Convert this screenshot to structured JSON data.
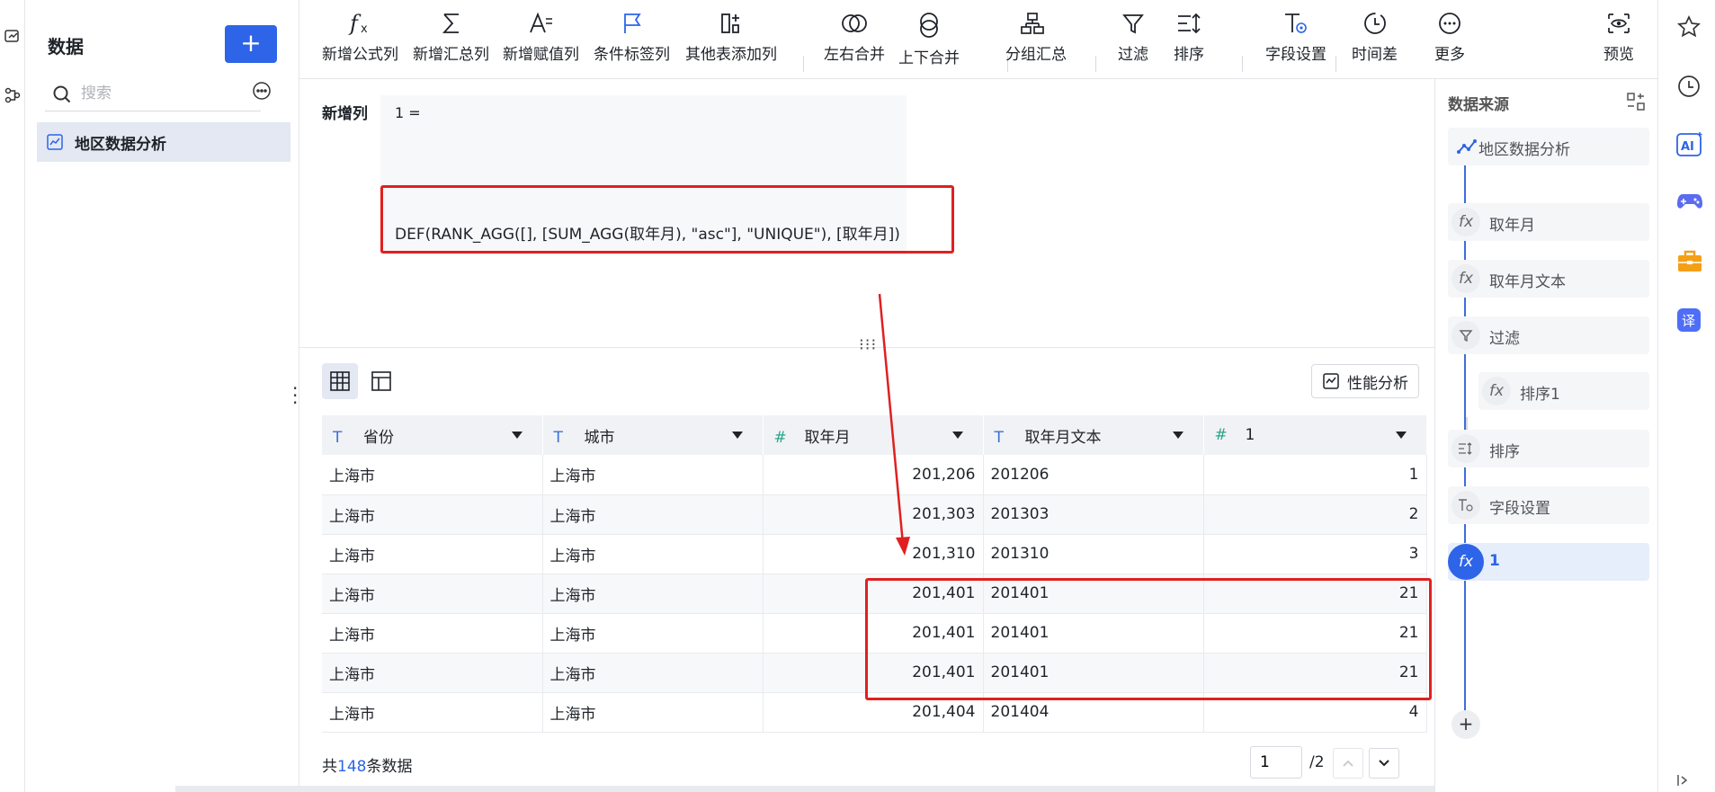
{
  "left_panel": {
    "title": "数据",
    "add_label": "+",
    "search_placeholder": "搜索",
    "dataset_name": "地区数据分析"
  },
  "toolbar": {
    "items": [
      {
        "label": "新增公式列",
        "icon": "formula-icon"
      },
      {
        "label": "新增汇总列",
        "icon": "sigma-icon"
      },
      {
        "label": "新增赋值列",
        "icon": "assign-icon"
      },
      {
        "label": "条件标签列",
        "icon": "flag-icon"
      },
      {
        "label": "其他表添加列",
        "icon": "add-column-icon"
      },
      {
        "label": "左右合并",
        "icon": "merge-horizontal-icon"
      },
      {
        "label": "上下合并",
        "icon": "merge-vertical-icon"
      },
      {
        "label": "分组汇总",
        "icon": "group-icon"
      },
      {
        "label": "过滤",
        "icon": "filter-icon"
      },
      {
        "label": "排序",
        "icon": "sort-icon"
      },
      {
        "label": "字段设置",
        "icon": "field-settings-icon"
      },
      {
        "label": "时间差",
        "icon": "clock-icon"
      },
      {
        "label": "更多",
        "icon": "more-icon"
      },
      {
        "label": "预览",
        "icon": "preview-eye-icon"
      }
    ]
  },
  "formula": {
    "label": "新增列",
    "equation": "1 =",
    "expression": "DEF(RANK_AGG([], [SUM_AGG(取年月), \"asc\"], \"UNIQUE\"), [取年月])"
  },
  "table": {
    "perf_label": "性能分析",
    "columns": [
      {
        "name": "省份",
        "type": "T"
      },
      {
        "name": "城市",
        "type": "T"
      },
      {
        "name": "取年月",
        "type": "#"
      },
      {
        "name": "取年月文本",
        "type": "T"
      },
      {
        "name": "1",
        "type": "#"
      }
    ],
    "rows": [
      [
        "上海市",
        "上海市",
        "201,206",
        "201206",
        "1"
      ],
      [
        "上海市",
        "上海市",
        "201,303",
        "201303",
        "2"
      ],
      [
        "上海市",
        "上海市",
        "201,310",
        "201310",
        "3"
      ],
      [
        "上海市",
        "上海市",
        "201,401",
        "201401",
        "21"
      ],
      [
        "上海市",
        "上海市",
        "201,401",
        "201401",
        "21"
      ],
      [
        "上海市",
        "上海市",
        "201,401",
        "201401",
        "21"
      ],
      [
        "上海市",
        "上海市",
        "201,404",
        "201404",
        "4"
      ]
    ]
  },
  "pagination": {
    "prefix": "共",
    "count": "148",
    "suffix": "条数据",
    "current_page": "1",
    "total_pages": "/2"
  },
  "data_source": {
    "title": "数据来源",
    "nodes": [
      {
        "label": "地区数据分析"
      },
      {
        "label": "取年月"
      },
      {
        "label": "取年月文本"
      },
      {
        "label": "过滤"
      },
      {
        "label": "排序1"
      },
      {
        "label": "排序"
      },
      {
        "label": "字段设置"
      },
      {
        "label": "1"
      }
    ],
    "add_label": "+"
  },
  "colors": {
    "accent": "#2d64e8",
    "highlight_red": "#e02020"
  }
}
